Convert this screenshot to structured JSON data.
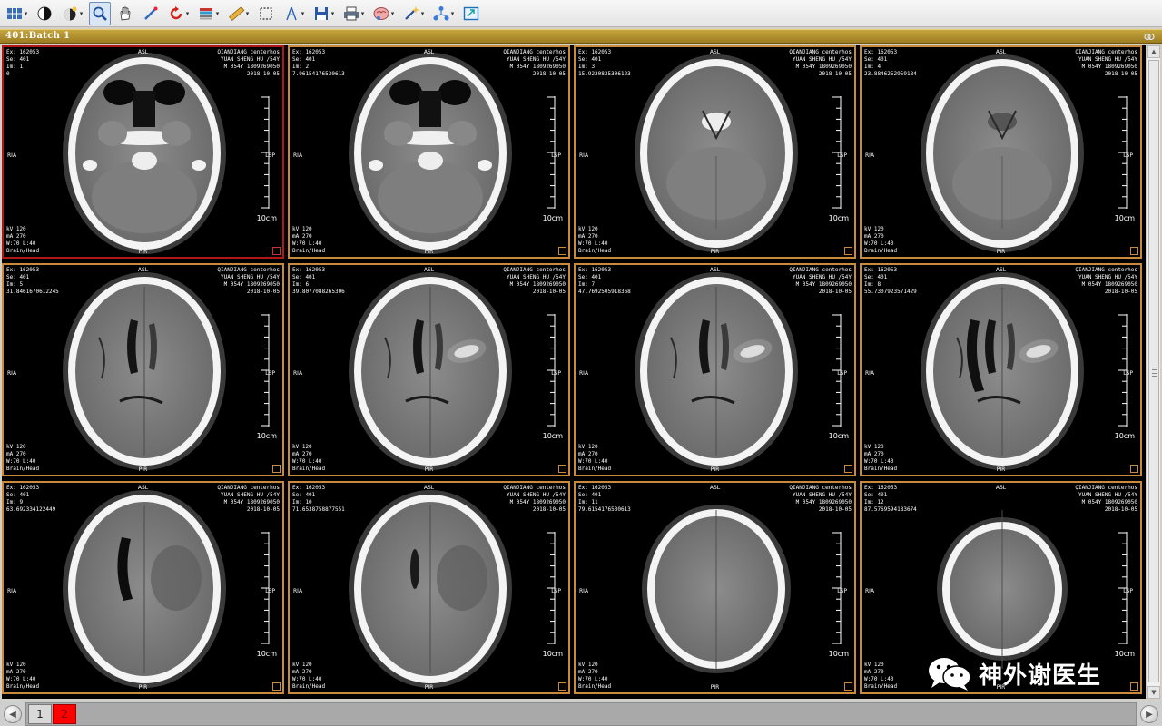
{
  "toolbar": {
    "tools": [
      {
        "name": "layout-grid-icon",
        "dropdown": true
      },
      {
        "name": "window-level-icon",
        "dropdown": false
      },
      {
        "name": "brightness-preset-icon",
        "dropdown": true
      },
      {
        "name": "zoom-magnifier-icon",
        "dropdown": false,
        "active": true
      },
      {
        "name": "pan-hand-icon",
        "dropdown": false
      },
      {
        "name": "measure-pen-icon",
        "dropdown": false
      },
      {
        "name": "rotate-icon",
        "dropdown": true
      },
      {
        "name": "color-lut-icon",
        "dropdown": true
      },
      {
        "name": "ruler-icon",
        "dropdown": true
      },
      {
        "name": "roi-select-icon",
        "dropdown": false
      },
      {
        "name": "angle-icon",
        "dropdown": true
      },
      {
        "name": "save-disk-icon",
        "dropdown": true
      },
      {
        "name": "print-icon",
        "dropdown": true
      },
      {
        "name": "brain-3d-icon",
        "dropdown": true
      },
      {
        "name": "magic-wand-icon",
        "dropdown": true
      },
      {
        "name": "network-icon",
        "dropdown": true
      },
      {
        "name": "fit-window-icon",
        "dropdown": false
      }
    ]
  },
  "series": {
    "title": "401:Batch 1"
  },
  "colors": {
    "cell_border": "#c98a3b",
    "selected_border": "#b01818",
    "series_bar": "#b08d2e",
    "active_page": "#ff0000"
  },
  "overlay": {
    "orient_top": "ASL",
    "orient_bottom": "PIR",
    "orient_left": "RIA",
    "orient_right": "LSP",
    "scale": "10cm",
    "institution": "QIANJIANG centerhos",
    "patient": "YUAN SHENG HU /54Y",
    "patient_id": "M 054Y 1809269050",
    "date": "2018-10-05",
    "kv": "kV 120",
    "ma": "mA 270",
    "window": "W:70 L:40",
    "protocol": "Brain/Head"
  },
  "images": [
    {
      "ex": "Ex: 162053",
      "se": "Se: 401",
      "im": "Im: 1",
      "pos": "0",
      "selected": true,
      "kind": "skullbase"
    },
    {
      "ex": "Ex: 162053",
      "se": "Se: 401",
      "im": "Im: 2",
      "pos": "7.96154176530613",
      "selected": false,
      "kind": "skullbase2"
    },
    {
      "ex": "Ex: 162053",
      "se": "Se: 401",
      "im": "Im: 3",
      "pos": "15.9230835306123",
      "selected": false,
      "kind": "posterior"
    },
    {
      "ex": "Ex: 162053",
      "se": "Se: 401",
      "im": "Im: 4",
      "pos": "23.8846252959184",
      "selected": false,
      "kind": "mid"
    },
    {
      "ex": "Ex: 162053",
      "se": "Se: 401",
      "im": "Im: 5",
      "pos": "31.8461670612245",
      "selected": false,
      "kind": "ventricle"
    },
    {
      "ex": "Ex: 162053",
      "se": "Se: 401",
      "im": "Im: 6",
      "pos": "39.8077088265306",
      "selected": false,
      "kind": "ventricle-bleed"
    },
    {
      "ex": "Ex: 162053",
      "se": "Se: 401",
      "im": "Im: 7",
      "pos": "47.7692505918368",
      "selected": false,
      "kind": "ventricle-bleed"
    },
    {
      "ex": "Ex: 162053",
      "se": "Se: 401",
      "im": "Im: 8",
      "pos": "55.7307923571429",
      "selected": false,
      "kind": "ventricle-bleed2"
    },
    {
      "ex": "Ex: 162053",
      "se": "Se: 401",
      "im": "Im: 9",
      "pos": "63.692334122449",
      "selected": false,
      "kind": "upper"
    },
    {
      "ex": "Ex: 162053",
      "se": "Se: 401",
      "im": "Im: 10",
      "pos": "71.6538758877551",
      "selected": false,
      "kind": "upper2"
    },
    {
      "ex": "Ex: 162053",
      "se": "Se: 401",
      "im": "Im: 11",
      "pos": "79.6154176530613",
      "selected": false,
      "kind": "vertex"
    },
    {
      "ex": "Ex: 162053",
      "se": "Se: 401",
      "im": "Im: 12",
      "pos": "87.5769594183674",
      "selected": false,
      "kind": "vertex2"
    }
  ],
  "watermark": {
    "text": "神外谢医生"
  },
  "pager": {
    "pages": [
      "1",
      "2"
    ],
    "active": "2"
  }
}
